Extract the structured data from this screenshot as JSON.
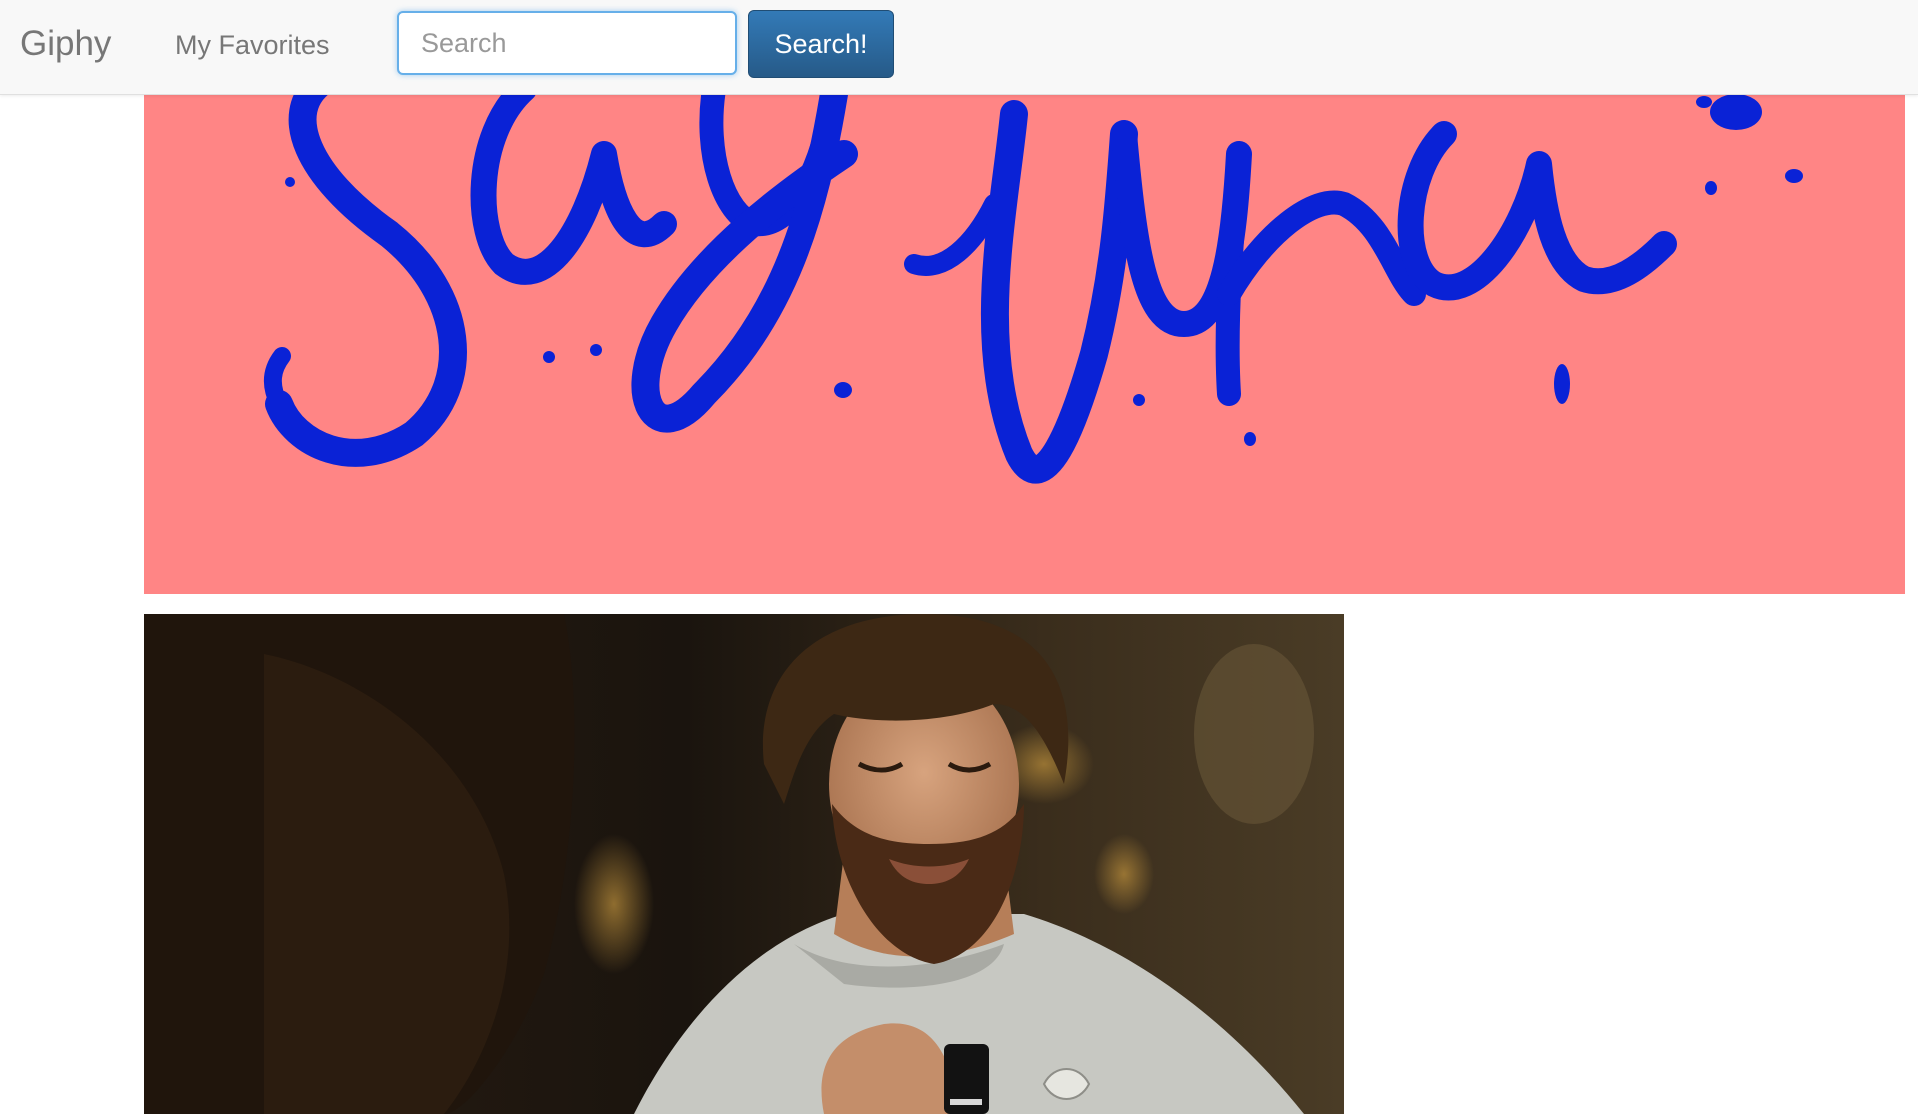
{
  "navbar": {
    "brand": "Giphy",
    "favorites_link": "My Favorites",
    "search": {
      "placeholder": "Search",
      "value": ""
    },
    "search_button_label": "Search!"
  },
  "colors": {
    "navbar_bg": "#f8f8f8",
    "brand_text": "#777777",
    "button_primary": "#2f6fa8",
    "pink_gif_bg": "#ff8585",
    "lettering_blue": "#0a22d6"
  },
  "gifs": [
    {
      "description": "hand-lettered-blue-script-on-pink"
    },
    {
      "description": "bearded-man-looking-down-at-phone"
    }
  ]
}
